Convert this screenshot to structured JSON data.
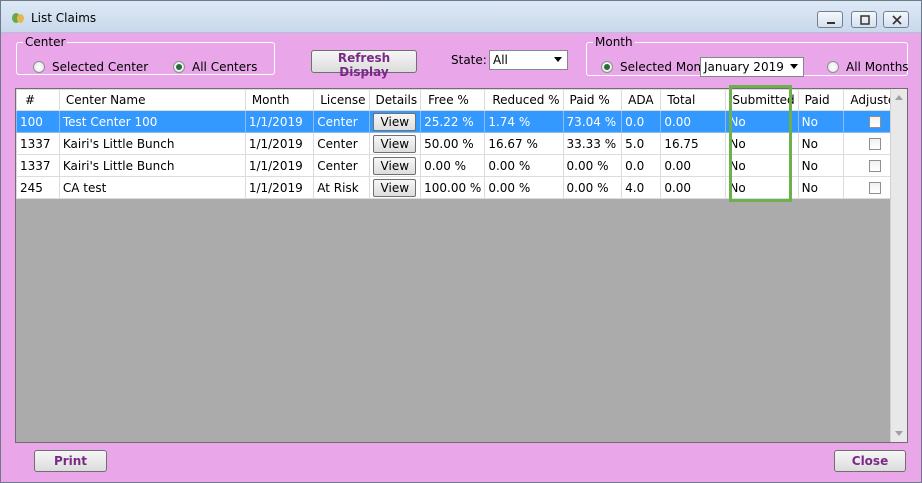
{
  "window": {
    "title": "List Claims",
    "icon": "app-leaf-icon"
  },
  "center_group": {
    "legend": "Center",
    "options": [
      {
        "label": "Selected Center",
        "checked": false
      },
      {
        "label": "All Centers",
        "checked": true
      }
    ]
  },
  "refresh_label": "Refresh Display",
  "state": {
    "label": "State:",
    "value": "All"
  },
  "month_group": {
    "legend": "Month",
    "selected_label": "Selected Month",
    "selected_checked": true,
    "month_value": "January 2019",
    "all_label": "All Months",
    "all_checked": false
  },
  "table": {
    "headers": [
      "#",
      "Center Name",
      "Month",
      "License",
      "Details",
      "Free %",
      "Reduced %",
      "Paid %",
      "ADA",
      "Total",
      "Submitted",
      "Paid",
      "Adjusted"
    ],
    "view_label": "View",
    "rows": [
      {
        "num": "100",
        "center": "Test Center 100",
        "month": "1/1/2019",
        "license": "Center",
        "free": "25.22 %",
        "reduced": "1.74 %",
        "paid_pct": "73.04 %",
        "ada": "0.0",
        "total": "0.00",
        "submitted": "No",
        "paid": "No",
        "adjusted": false,
        "selected": true
      },
      {
        "num": "1337",
        "center": "Kairi's Little Bunch",
        "month": "1/1/2019",
        "license": "Center",
        "free": "50.00 %",
        "reduced": "16.67 %",
        "paid_pct": "33.33 %",
        "ada": "5.0",
        "total": "16.75",
        "submitted": "No",
        "paid": "No",
        "adjusted": false,
        "selected": false
      },
      {
        "num": "1337",
        "center": "Kairi's Little Bunch",
        "month": "1/1/2019",
        "license": "Center",
        "free": "0.00 %",
        "reduced": "0.00 %",
        "paid_pct": "0.00 %",
        "ada": "0.0",
        "total": "0.00",
        "submitted": "No",
        "paid": "No",
        "adjusted": false,
        "selected": false
      },
      {
        "num": "245",
        "center": "CA test",
        "month": "1/1/2019",
        "license": "At Risk",
        "free": "100.00 %",
        "reduced": "0.00 %",
        "paid_pct": "0.00 %",
        "ada": "4.0",
        "total": "0.00",
        "submitted": "No",
        "paid": "No",
        "adjusted": false,
        "selected": false
      }
    ]
  },
  "print_label": "Print",
  "close_label": "Close",
  "colors": {
    "background": "#e9a7ea",
    "selection": "#3399ff",
    "highlight": "#6cb14b",
    "button_text": "#7a2a86"
  }
}
